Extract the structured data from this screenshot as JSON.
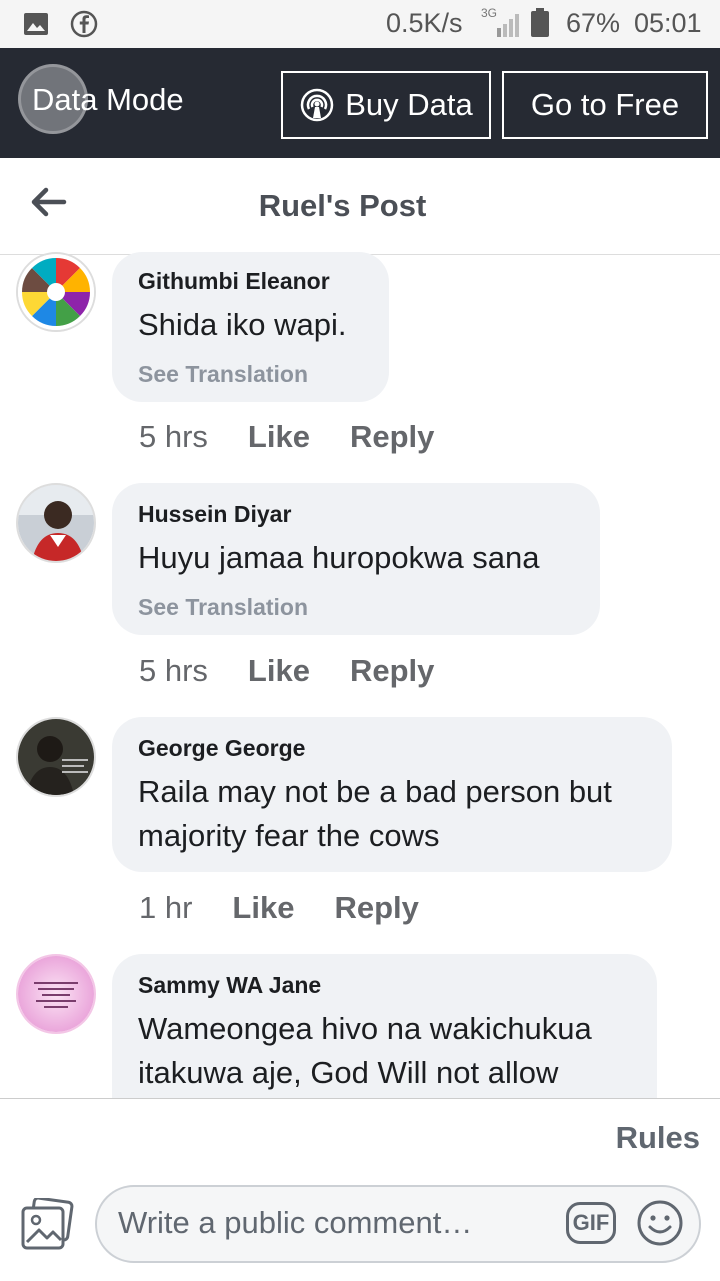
{
  "status_bar": {
    "speed": "0.5K/s",
    "network": "3G",
    "battery": "67%",
    "time": "05:01"
  },
  "data_bar": {
    "mode_label": "Data Mode",
    "buy_label": "Buy Data",
    "free_label": "Go to Free"
  },
  "header": {
    "title": "Ruel's Post"
  },
  "comments": [
    {
      "author": "Githumbi Eleanor",
      "text": "Shida iko wapi.",
      "translation": "See Translation",
      "time": "5 hrs",
      "like": "Like",
      "reply": "Reply"
    },
    {
      "author": "Hussein Diyar",
      "text": "Huyu jamaa huropokwa sana",
      "translation": "See Translation",
      "time": "5 hrs",
      "like": "Like",
      "reply": "Reply"
    },
    {
      "author": "George George",
      "text": "Raila may not be a bad person but majority fear the cows",
      "time": "1 hr",
      "like": "Like",
      "reply": "Reply"
    },
    {
      "author": "Sammy WA Jane",
      "text": "Wameongea hivo na wakichukua itakuwa aje, God Will not allow"
    }
  ],
  "footer": {
    "rules": "Rules",
    "placeholder": "Write a public comment…",
    "gif": "GIF"
  },
  "icons": {
    "back": "arrow-left-icon",
    "photo": "photo-icon",
    "emoji": "emoji-icon",
    "gif": "gif-icon",
    "buy": "broadcast-icon"
  }
}
